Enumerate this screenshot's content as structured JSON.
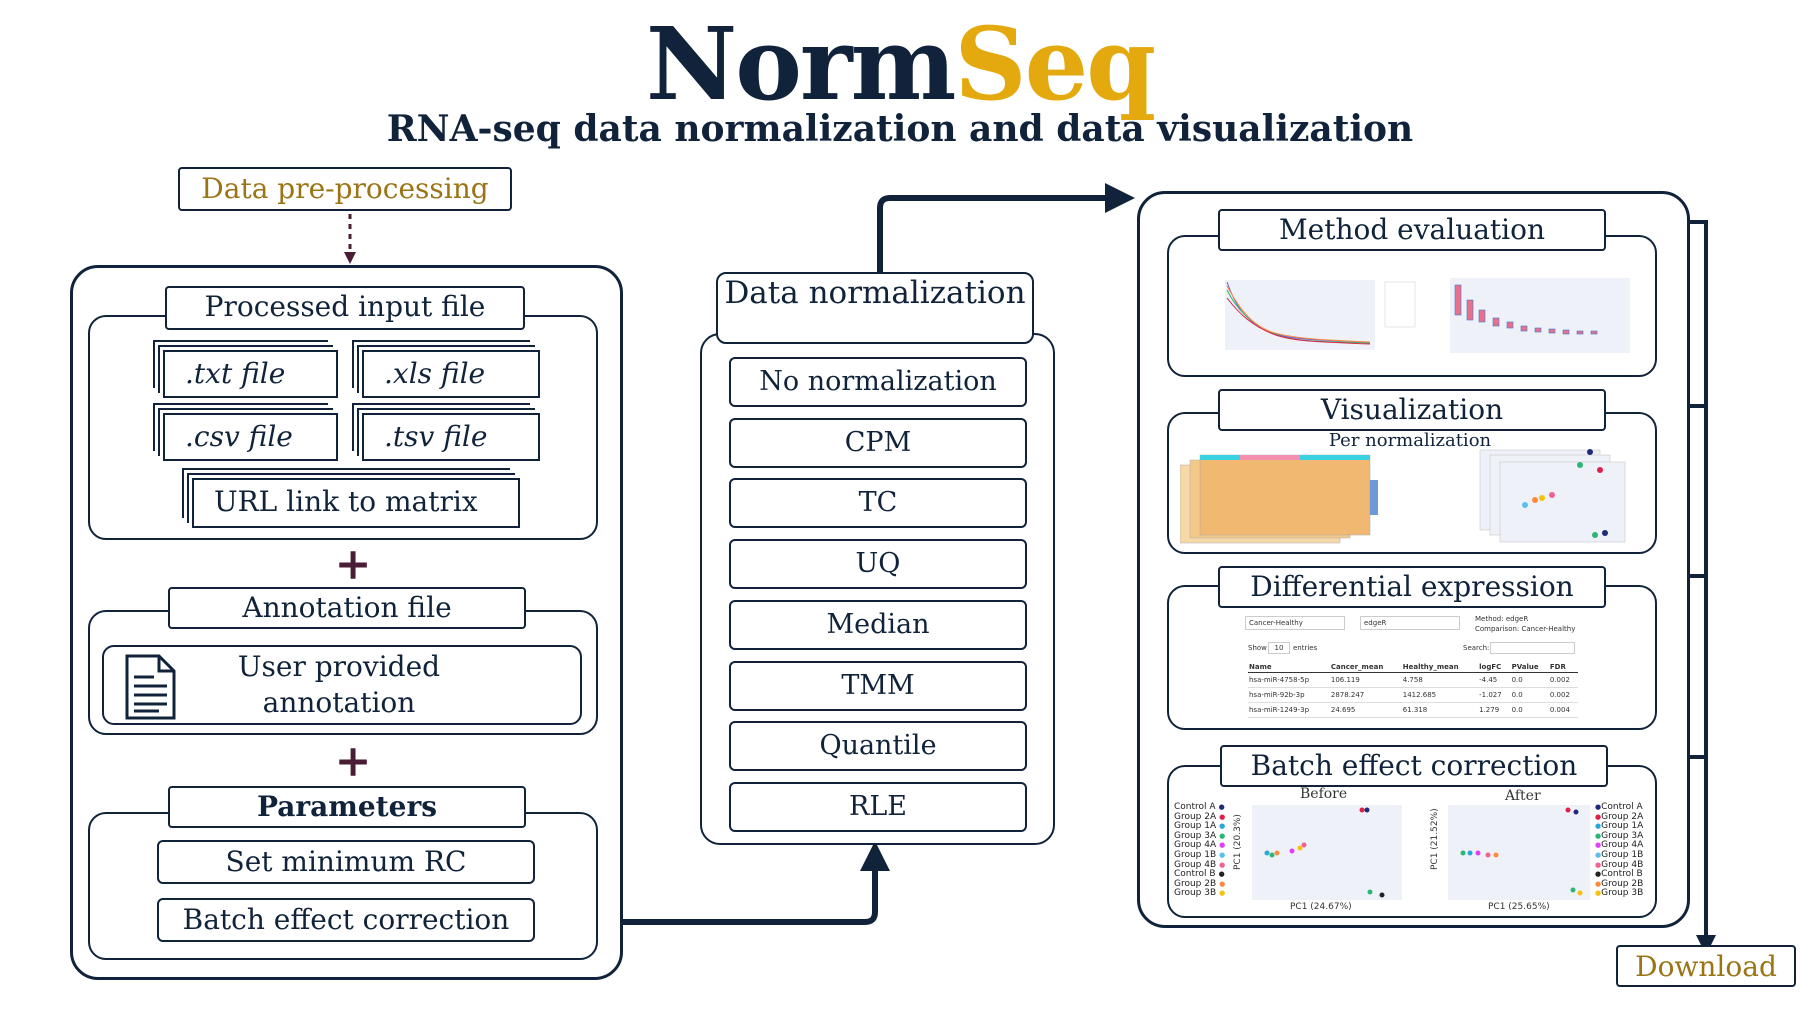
{
  "title": {
    "part1": "Norm",
    "part2": "Seq"
  },
  "subtitle": "RNA-seq data normalization and data visualization",
  "preprocessing": {
    "label": "Data pre-processing",
    "input": {
      "title": "Processed input file",
      "files": [
        ".txt file",
        ".xls file",
        ".csv file",
        ".tsv file"
      ],
      "url": "URL link to matrix"
    },
    "annotation": {
      "title": "Annotation file",
      "item": "User provided annotation"
    },
    "parameters": {
      "title": "Parameters",
      "items": [
        "Set minimum RC",
        "Batch effect correction"
      ]
    },
    "plus": "+"
  },
  "normalization": {
    "title": "Data normalization",
    "methods": [
      "No normalization",
      "CPM",
      "TC",
      "UQ",
      "Median",
      "TMM",
      "Quantile",
      "RLE"
    ]
  },
  "results": {
    "method_evaluation": "Method evaluation",
    "visualization": {
      "title": "Visualization",
      "sub": "Per normalization"
    },
    "differential": {
      "title": "Differential expression",
      "select1": "Cancer-Healthy",
      "select2": "edgeR",
      "method_line": "Method: edgeR",
      "comparison_line": "Comparison: Cancer-Healthy",
      "show": "Show",
      "show_val": "10",
      "entries": "entries",
      "search": "Search:",
      "columns": [
        "Name",
        "Cancer_mean",
        "Healthy_mean",
        "logFC",
        "PValue",
        "FDR"
      ],
      "rows": [
        [
          "hsa-miR-4758-5p",
          "106.119",
          "4.758",
          "-4.45",
          "0.0",
          "0.002"
        ],
        [
          "hsa-miR-92b-3p",
          "2878.247",
          "1412.685",
          "-1.027",
          "0.0",
          "0.002"
        ],
        [
          "hsa-miR-1249-3p",
          "24.695",
          "61.318",
          "1.279",
          "0.0",
          "0.004"
        ]
      ]
    },
    "batch": {
      "title": "Batch effect correction",
      "before": "Before",
      "after": "After",
      "before_x": "PC1 (24.67%)",
      "before_y": "PC1 (20.3%)",
      "after_x": "PC1 (25.65%)",
      "after_y": "PC1 (21.52%)",
      "legend": [
        "Control A",
        "Group 2A",
        "Group 1A",
        "Group 3A",
        "Group 4A",
        "Group 1B",
        "Group 4B",
        "Control B",
        "Group 2B",
        "Group 3B"
      ],
      "legend_colors": [
        "#1f2a7a",
        "#e0204a",
        "#28a7d9",
        "#2bb673",
        "#e040fb",
        "#5bc0eb",
        "#f06292",
        "#222222",
        "#ff8a3d",
        "#f4c20d"
      ]
    },
    "download": "Download"
  },
  "colors": {
    "navy": "#10233a",
    "gold": "#e3a90e",
    "gold_text": "#9b7416",
    "plus": "#4a1d36"
  }
}
